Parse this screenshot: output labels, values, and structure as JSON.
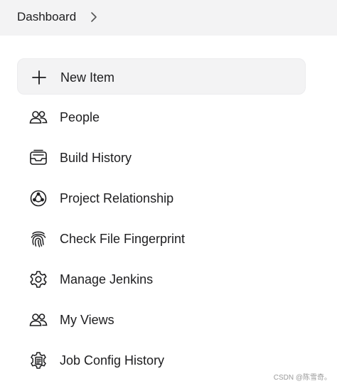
{
  "breadcrumb": {
    "label": "Dashboard",
    "separator_icon": "chevron-right-icon"
  },
  "menu": {
    "items": [
      {
        "label": "New Item",
        "icon": "plus-icon",
        "active": true
      },
      {
        "label": "People",
        "icon": "people-icon",
        "active": false
      },
      {
        "label": "Build History",
        "icon": "inbox-history-icon",
        "active": false
      },
      {
        "label": "Project Relationship",
        "icon": "relationship-icon",
        "active": false
      },
      {
        "label": "Check File Fingerprint",
        "icon": "fingerprint-icon",
        "active": false
      },
      {
        "label": "Manage Jenkins",
        "icon": "gear-icon",
        "active": false
      },
      {
        "label": "My Views",
        "icon": "people-icon",
        "active": false
      },
      {
        "label": "Job Config History",
        "icon": "job-config-icon",
        "active": false
      }
    ]
  },
  "watermark": "CSDN @陈雪奇。",
  "colors": {
    "topbar_bg": "#f3f3f4",
    "active_item_bg": "#f3f3f4",
    "text": "#1d1d1f"
  }
}
